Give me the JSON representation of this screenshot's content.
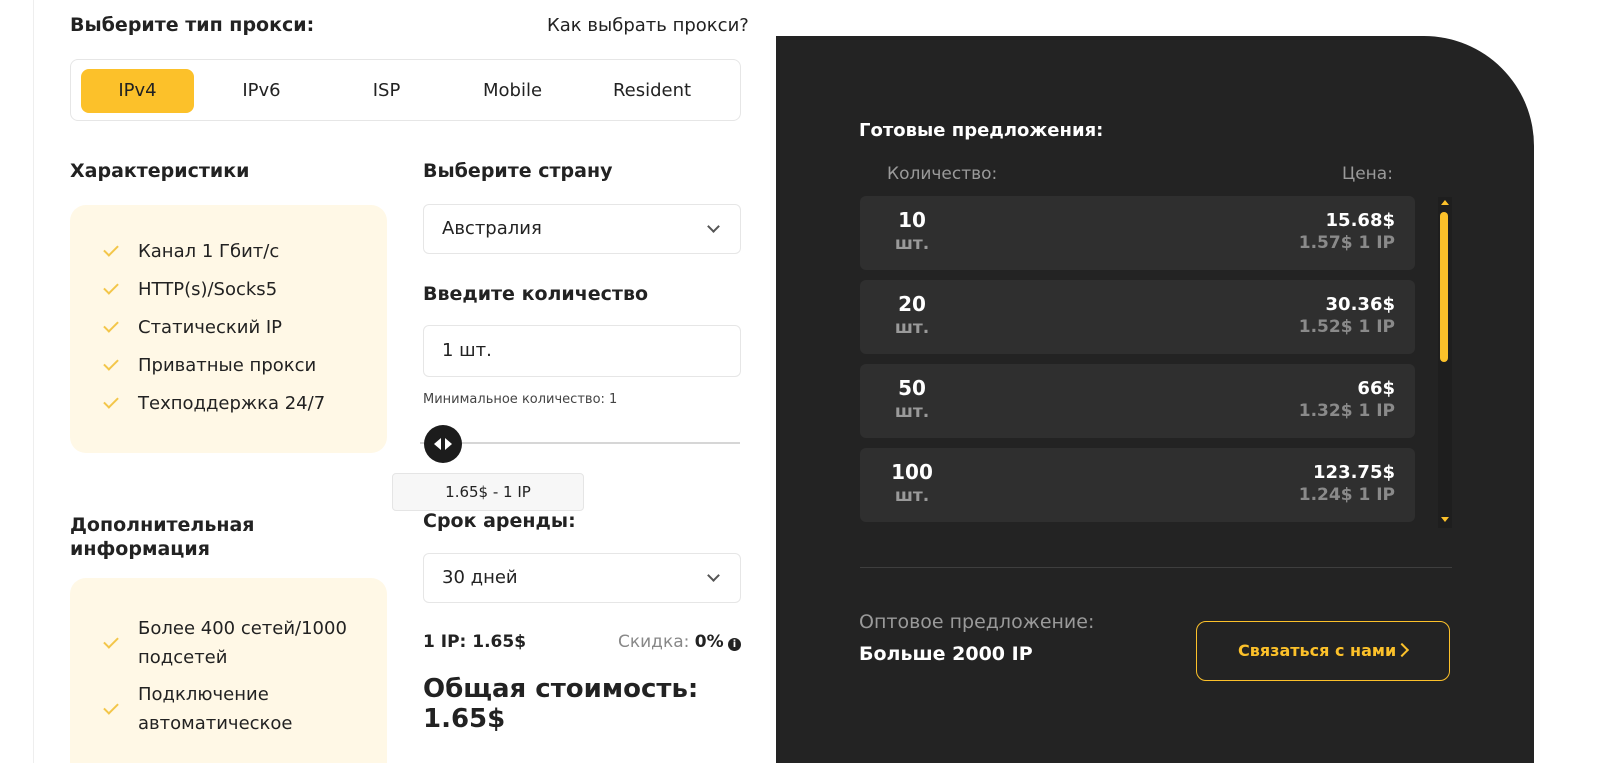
{
  "proxy_type": {
    "title": "Выберите тип прокси:",
    "how_to_link": "Как выбрать прокси?",
    "tabs": [
      "IPv4",
      "IPv6",
      "ISP",
      "Mobile",
      "Resident"
    ],
    "active_tab": "IPv4"
  },
  "characteristics": {
    "title": "Характеристики",
    "items": [
      "Канал 1 Гбит/с",
      "HTTP(s)/Socks5",
      "Статический IP",
      "Приватные прокси",
      "Техподдержка 24/7"
    ]
  },
  "additional": {
    "title_line1": "Дополнительная",
    "title_line2": "информация",
    "items": [
      {
        "line1": "Более 400 сетей/1000",
        "line2": "подсетей"
      },
      {
        "line1": "Подключение",
        "line2": "автоматическое"
      }
    ]
  },
  "country": {
    "title": "Выберите страну",
    "selected": "Австралия"
  },
  "quantity": {
    "title": "Введите количество",
    "value": "1 шт.",
    "min_note": "Минимальное количество: 1",
    "tooltip": "1.65$ - 1 IP"
  },
  "rent": {
    "title": "Срок аренды:",
    "selected": "30 дней"
  },
  "summary": {
    "per_ip": "1 IP: 1.65$",
    "discount_label": "Скидка:",
    "discount_value": "0%",
    "total_label": "Общая стоимость:",
    "total_value": "1.65$"
  },
  "offers": {
    "title": "Готовые предложения:",
    "qty_header": "Количество:",
    "price_header": "Цена:",
    "rows": [
      {
        "qty": "10",
        "unit": "шт.",
        "price": "15.68$",
        "per_ip": "1.57$ 1 IP"
      },
      {
        "qty": "20",
        "unit": "шт.",
        "price": "30.36$",
        "per_ip": "1.52$ 1 IP"
      },
      {
        "qty": "50",
        "unit": "шт.",
        "price": "66$",
        "per_ip": "1.32$ 1 IP"
      },
      {
        "qty": "100",
        "unit": "шт.",
        "price": "123.75$",
        "per_ip": "1.24$ 1 IP"
      }
    ]
  },
  "wholesale": {
    "label": "Оптовое предложение:",
    "value": "Больше 2000 IP",
    "button": "Связаться с нами"
  },
  "colors": {
    "accent": "#fcc12a",
    "dark_panel": "#232323",
    "card_bg": "#fff8e6"
  }
}
